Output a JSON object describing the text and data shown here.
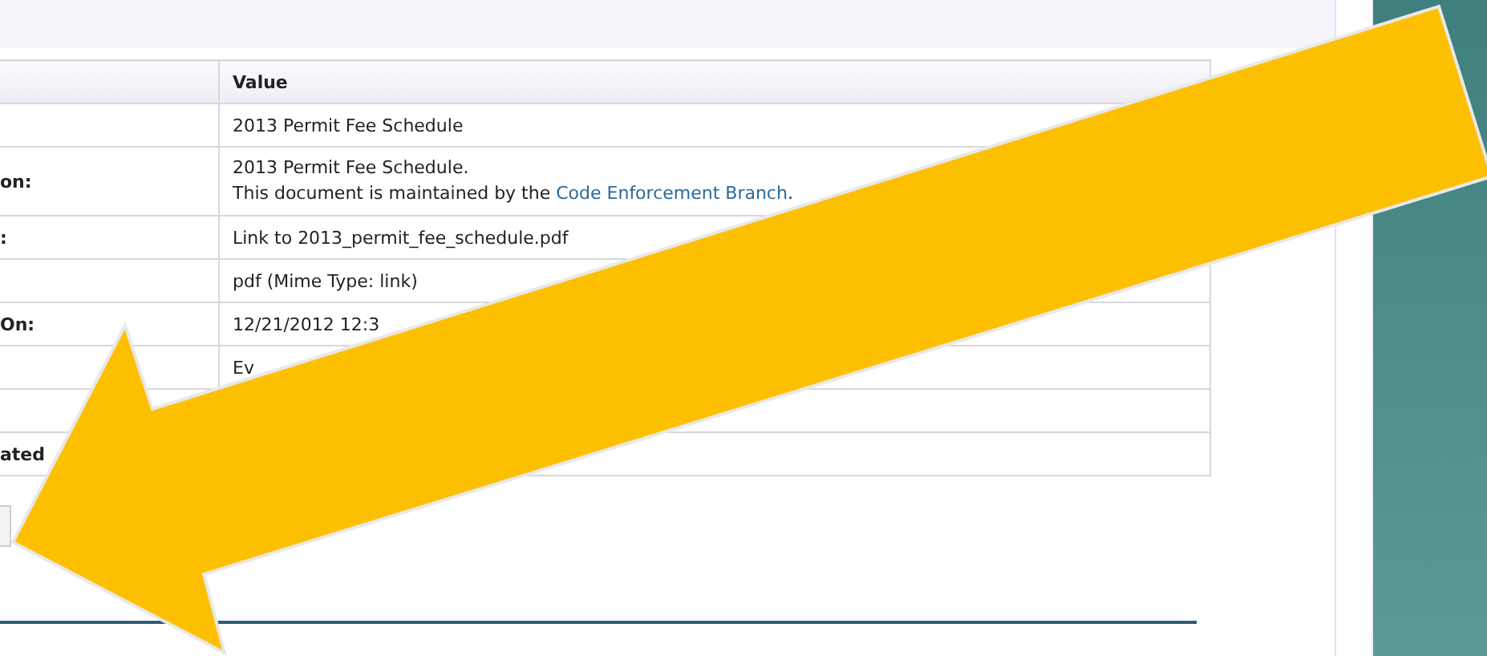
{
  "table": {
    "value_heading": "Value",
    "rows": [
      {
        "value": "2013 Permit Fee Schedule"
      },
      {
        "label": "on:",
        "kind": "description",
        "first_line": "2013 Permit Fee Schedule.",
        "text": "This document is maintained by the ",
        "link": "Code Enforcement Branch",
        "after": "."
      },
      {
        "label": ":",
        "value": "Link to 2013_permit_fee_schedule.pdf"
      },
      {
        "value": "pdf (Mime Type: link)"
      },
      {
        "label": "On:",
        "value": "12/21/2012 12:3"
      },
      {
        "value": "Ev"
      },
      {},
      {
        "label": "ated"
      }
    ]
  }
}
